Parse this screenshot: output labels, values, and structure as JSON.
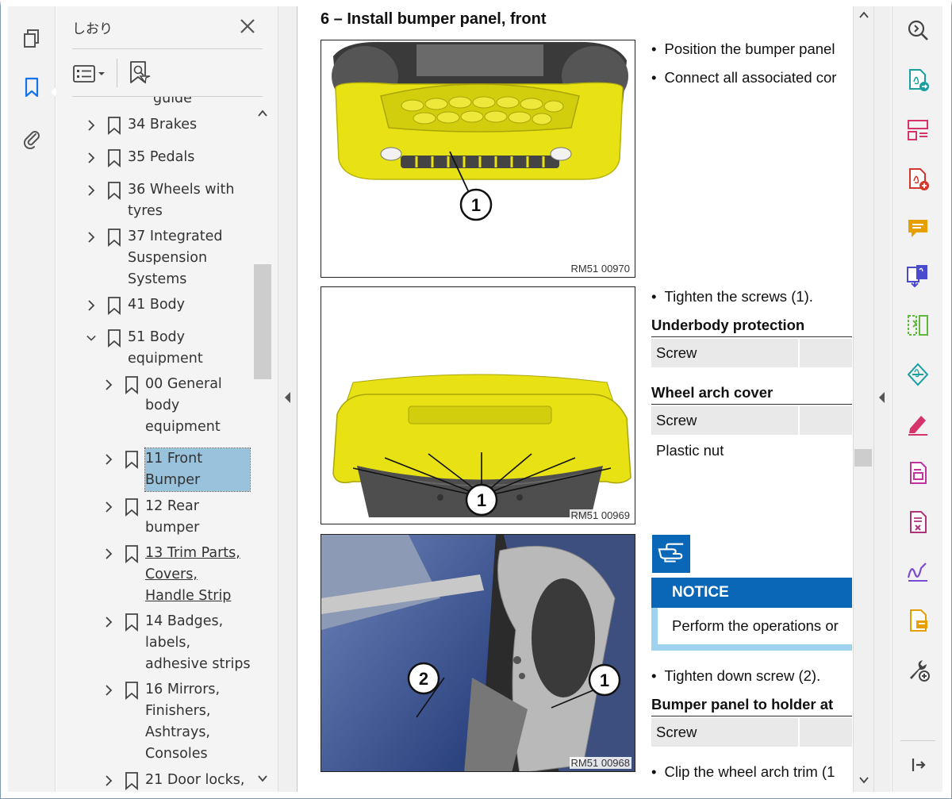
{
  "bookmarks_panel": {
    "title": "しおり",
    "items": [
      {
        "label": "guide",
        "level": 0,
        "expanded": false,
        "selected": false,
        "underlined": false
      },
      {
        "label": "34 Brakes",
        "level": 0,
        "expanded": false,
        "selected": false,
        "underlined": false
      },
      {
        "label": "35 Pedals",
        "level": 0,
        "expanded": false,
        "selected": false,
        "underlined": false
      },
      {
        "label": "36 Wheels with tyres",
        "level": 0,
        "expanded": false,
        "selected": false,
        "underlined": false
      },
      {
        "label": "37 Integrated Suspension Systems",
        "level": 0,
        "expanded": false,
        "selected": false,
        "underlined": false
      },
      {
        "label": "41 Body",
        "level": 0,
        "expanded": false,
        "selected": false,
        "underlined": false
      },
      {
        "label": "51 Body equipment",
        "level": 0,
        "expanded": true,
        "selected": false,
        "underlined": false
      },
      {
        "label": "00 General body equipment",
        "level": 1,
        "expanded": false,
        "selected": false,
        "underlined": false
      },
      {
        "label": "11 Front Bumper",
        "level": 1,
        "expanded": false,
        "selected": true,
        "underlined": false
      },
      {
        "label": "12 Rear bumper",
        "level": 1,
        "expanded": false,
        "selected": false,
        "underlined": false
      },
      {
        "label": "13 Trim Parts, Covers, Handle Strip",
        "level": 1,
        "expanded": false,
        "selected": false,
        "underlined": true
      },
      {
        "label": "14 Badges, labels, adhesive strips",
        "level": 1,
        "expanded": false,
        "selected": false,
        "underlined": false
      },
      {
        "label": "16 Mirrors, Finishers, Ashtrays, Consoles",
        "level": 1,
        "expanded": false,
        "selected": false,
        "underlined": false
      },
      {
        "label": "21 Door locks,",
        "level": 1,
        "expanded": false,
        "selected": false,
        "underlined": false
      }
    ]
  },
  "document": {
    "heading": "6 – Install bumper panel, front",
    "figures": [
      {
        "caption": "RM51 00970",
        "callouts": [
          "1"
        ]
      },
      {
        "caption": "RM51 00969",
        "callouts": [
          "1"
        ]
      },
      {
        "caption": "RM51 00968",
        "callouts": [
          "1",
          "2"
        ]
      }
    ],
    "step1_bullets": [
      "Position the bumper panel",
      "Connect all associated cor"
    ],
    "step2_bullet": "Tighten the screws (1).",
    "underbody": {
      "title": "Underbody protection",
      "rows": [
        "Screw"
      ]
    },
    "wheel_arch": {
      "title": "Wheel arch cover",
      "rows": [
        "Screw"
      ],
      "extra": "Plastic nut"
    },
    "notice": {
      "title": "NOTICE",
      "text": "Perform the operations or"
    },
    "step3_bullet": "Tighten down screw (2).",
    "bumper_holder": {
      "title": "Bumper panel to holder at",
      "rows": [
        "Screw"
      ]
    },
    "step4_bullet": "Clip the wheel arch trim (1"
  },
  "colors": {
    "accent_blue": "#0a66b7",
    "selection": "#99c2dc",
    "bumper_yellow": "#e8e214",
    "notice_border": "#9fd3ef"
  },
  "left_rail_icons": [
    "page-thumbnails-icon",
    "bookmark-icon",
    "attachment-icon"
  ],
  "right_rail_tools": [
    "zoom-icon",
    "export-pdf-icon",
    "organize-pages-icon",
    "create-pdf-icon",
    "comment-icon",
    "combine-files-icon",
    "compress-icon",
    "scan-ocr-icon",
    "fill-sign-icon",
    "edit-pdf-icon",
    "redact-icon",
    "request-signature-icon",
    "send-comments-icon",
    "more-tools-icon",
    "collapse-pane-icon"
  ]
}
